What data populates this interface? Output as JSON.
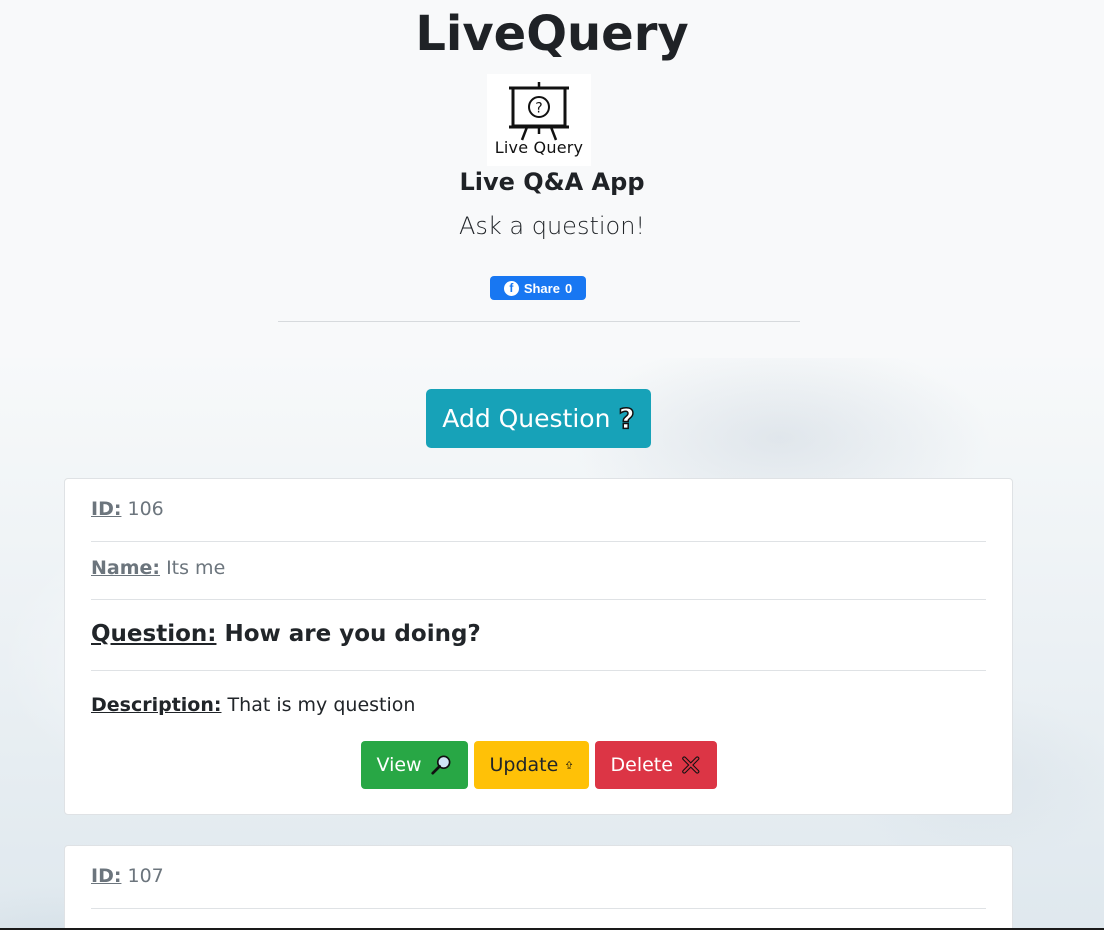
{
  "header": {
    "title": "LiveQuery",
    "logo_text": "Live Query",
    "subtitle": "Live Q&A App",
    "tagline": "Ask a question!",
    "share_label": "Share",
    "share_count": "0"
  },
  "actions": {
    "add_question_label": "Add Question"
  },
  "labels": {
    "id": "ID:",
    "name": "Name:",
    "question": "Question:",
    "description": "Description:"
  },
  "questions": [
    {
      "id": "106",
      "name": "Its me",
      "question": "How are you doing?",
      "description": "That is my question",
      "buttons": {
        "view": "View",
        "update": "Update",
        "delete": "Delete"
      }
    },
    {
      "id": "107",
      "name": "",
      "question": "",
      "description": ""
    }
  ],
  "colors": {
    "hero_bg": "#f8f9fa",
    "info": "#17a2b8",
    "success": "#28a745",
    "warning": "#ffc107",
    "danger": "#dc3545",
    "facebook": "#1877f2",
    "muted": "#6c757d"
  },
  "icons": {
    "logo": "presentation-board-question-icon",
    "add": "question-mark-icon",
    "view": "magnifier-icon",
    "update": "up-arrow-icon",
    "delete": "cross-icon",
    "share": "facebook-icon"
  }
}
